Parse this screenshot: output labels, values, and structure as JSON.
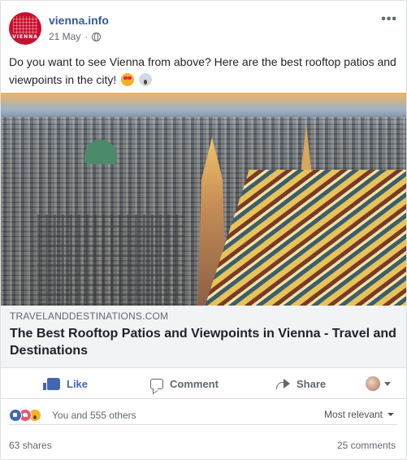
{
  "post": {
    "page_name": "vienna.info",
    "avatar_text": "VIENNA",
    "date": "21 May",
    "separator": "·",
    "text": "Do you want to see Vienna from above? Here are the best rooftop patios and viewpoints in the city!",
    "emojis": [
      "heart-eyes-emoji",
      "scream-emoji"
    ],
    "privacy_icon": "globe-icon",
    "more_icon": "more-options-icon",
    "more_label": "•••"
  },
  "link": {
    "domain": "TRAVELANDDESTINATIONS.COM",
    "title": "The Best Rooftop Patios and Viewpoints in Vienna - Travel and Destinations"
  },
  "actions": {
    "like": "Like",
    "comment": "Comment",
    "share": "Share"
  },
  "reactions": {
    "summary": "You and 555 others",
    "icons": [
      "like",
      "love",
      "wow"
    ],
    "sort": "Most relevant"
  },
  "stats": {
    "shares": "63 shares",
    "comments": "25 comments"
  },
  "colors": {
    "link_blue": "#365899",
    "like_blue": "#4267b2",
    "muted_text": "#606770",
    "link_box_bg": "#f2f3f5"
  }
}
